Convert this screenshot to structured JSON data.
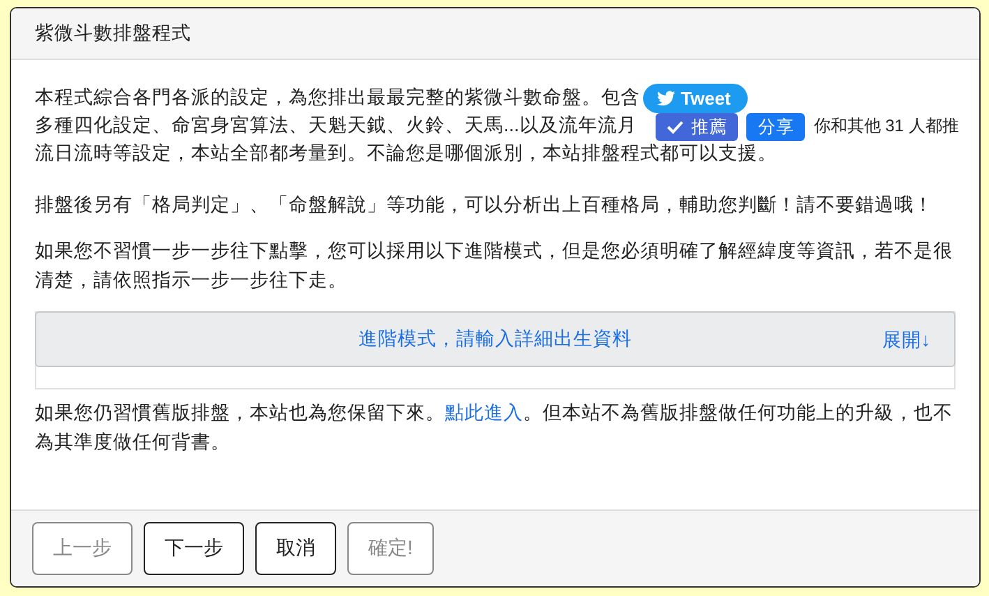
{
  "dialog": {
    "title": "紫微斗數排盤程式"
  },
  "intro": {
    "line_1": "本程式綜合各門各派的設定，為您排出最最完整的紫微斗數命盤。包含",
    "line_2": "多種四化設定、命宮身宮算法、天魁天鉞、火鈴、天馬...以及流年流月",
    "line_3": "流日流時等設定，本站全部都考量到。不論您是哪個派別，本站排盤程式都可以支援。"
  },
  "tweet_button": "Tweet",
  "like_widget": {
    "like": "推薦",
    "share": "分享",
    "count_text": "你和其他 31 人都推"
  },
  "paragraph_2": "排盤後另有「格局判定」、「命盤解說」等功能，可以分析出上百種格局，輔助您判斷！請不要錯過哦！",
  "paragraph_3": "如果您不習慣一步一步往下點擊，您可以採用以下進階模式，但是您必須明確了解經緯度等資訊，若不是很清楚，請依照指示一步一步往下走。",
  "advanced_panel": {
    "title": "進階模式，請輸入詳細出生資料",
    "toggle": "展開↓"
  },
  "paragraph_4": {
    "before": "如果您仍習慣舊版排盤，本站也為您保留下來。",
    "link": "點此進入",
    "after": "。但本站不為舊版排盤做任何功能上的升級，也不為其準度做任何背書。"
  },
  "buttons": [
    {
      "label": "上一步",
      "disabled": true
    },
    {
      "label": "下一步",
      "disabled": false
    },
    {
      "label": "取消",
      "disabled": false
    },
    {
      "label": "確定!",
      "disabled": true
    }
  ]
}
